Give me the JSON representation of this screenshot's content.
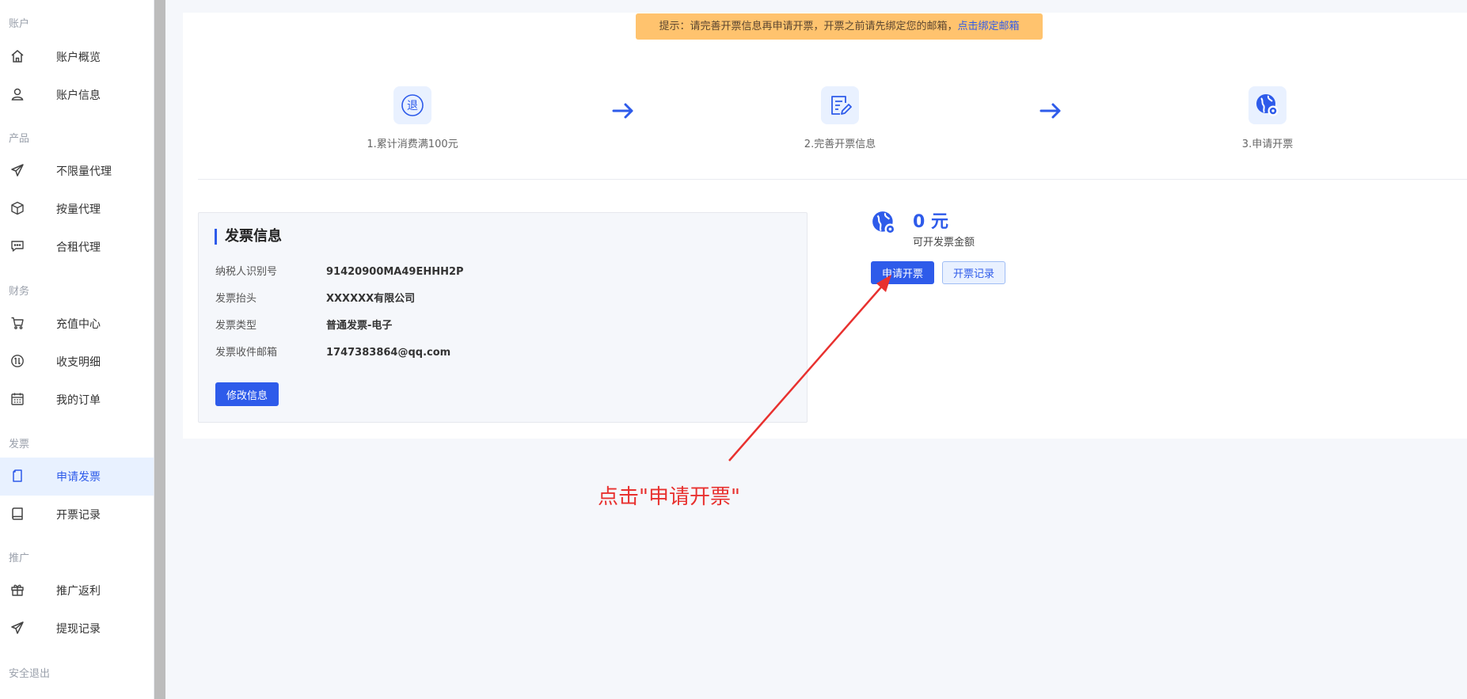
{
  "sidebar": {
    "sections": {
      "account": "账户",
      "product": "产品",
      "finance": "财务",
      "invoice": "发票",
      "promotion": "推广",
      "logout": "安全退出"
    },
    "items": {
      "overview": "账户概览",
      "account_info": "账户信息",
      "unlimited_proxy": "不限量代理",
      "metered_proxy": "按量代理",
      "rental_proxy": "合租代理",
      "recharge": "充值中心",
      "transactions": "收支明细",
      "orders": "我的订单",
      "apply_invoice": "申请发票",
      "invoice_records": "开票记录",
      "referral_rebate": "推广返利",
      "withdraw_records": "提现记录"
    }
  },
  "notice": {
    "text": "提示：请完善开票信息再申请开票，开票之前请先绑定您的邮箱，",
    "link": "点击绑定邮箱"
  },
  "steps": {
    "step1_glyph": "退",
    "step1": "1.累计消费满100元",
    "step2": "2.完善开票信息",
    "step3": "3.申请开票"
  },
  "invoice_info": {
    "title": "发票信息",
    "rows": [
      {
        "key": "纳税人识别号",
        "value": "91420900MA49EHHH2P"
      },
      {
        "key": "发票抬头",
        "value": "XXXXXX有限公司"
      },
      {
        "key": "发票类型",
        "value": "普通发票-电子"
      },
      {
        "key": "发票收件邮箱",
        "value": "1747383864@qq.com"
      }
    ],
    "edit_button": "修改信息"
  },
  "amount": {
    "value": "0 元",
    "label": "可开发票金额",
    "apply_button": "申请开票",
    "records_button": "开票记录"
  },
  "annotation": {
    "text": "点击\"申请开票\"",
    "color": "#e8312f"
  },
  "colors": {
    "accent": "#2e5bea",
    "notice_bg": "#ffc36e",
    "active_bg": "#e8f1ff"
  }
}
